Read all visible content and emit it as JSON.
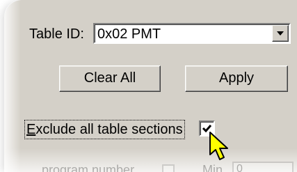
{
  "table_id": {
    "label": "Table ID:",
    "value": "0x02 PMT"
  },
  "buttons": {
    "clear_all": "Clear All",
    "apply": "Apply"
  },
  "exclude": {
    "label_first": "E",
    "label_rest": "xclude all table sections",
    "checked": true
  },
  "faded_row": {
    "left_label": "program number",
    "min_label": "Min",
    "min_value": "0"
  },
  "icons": {
    "dropdown": "chevron-down-icon",
    "check": "checkmark-icon",
    "cursor": "arrow-cursor-icon"
  },
  "colors": {
    "panel": "#d4d0c8",
    "cursor_fill": "#ffff00"
  }
}
